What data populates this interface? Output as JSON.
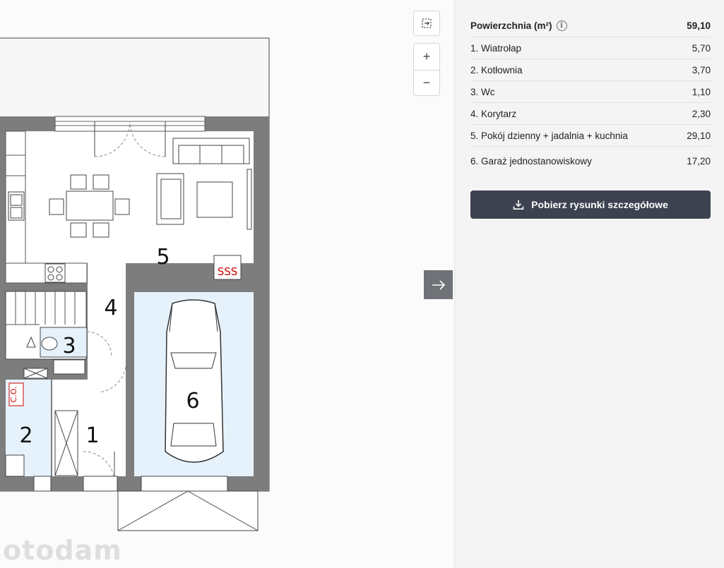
{
  "plan": {
    "room_numbers": [
      "1",
      "2",
      "3",
      "4",
      "5",
      "6"
    ],
    "radiator_text": "SSS",
    "boiler_text": "C.O."
  },
  "controls": {
    "fit_icon": "fit-to-screen-icon",
    "zoom_in": "+",
    "zoom_out": "−",
    "collapse_icon": "arrow-right-icon"
  },
  "watermark": "otodam",
  "areas": {
    "header_label": "Powierzchnia (m²)",
    "header_value": "59,10",
    "rooms": [
      {
        "label": "1. Wiatrołap",
        "value": "5,70"
      },
      {
        "label": "2. Kotłownia",
        "value": "3,70"
      },
      {
        "label": "3. Wc",
        "value": "1,10"
      },
      {
        "label": "4. Korytarz",
        "value": "2,30"
      },
      {
        "label": "5. Pokój dzienny + jadalnia + kuchnia",
        "value": "29,10"
      },
      {
        "label": "6. Garaż jednostanowiskowy",
        "value": "17,20"
      }
    ]
  },
  "download": {
    "label": "Pobierz rysunki szczegółowe",
    "icon": "download-icon",
    "color": "#3d4250"
  }
}
